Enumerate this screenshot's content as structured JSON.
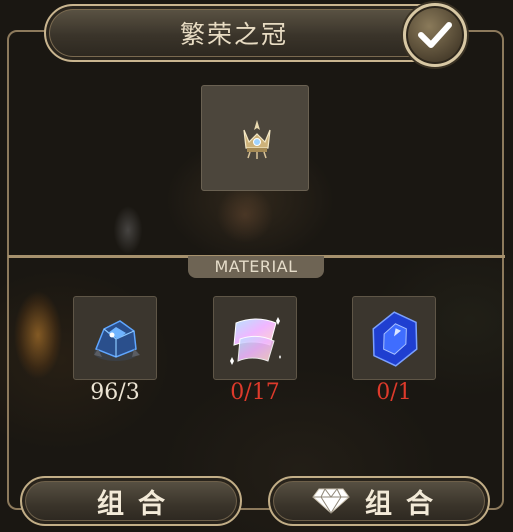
{
  "window": {
    "title": "繁荣之冠",
    "confirm_icon": "checkmark-icon"
  },
  "result": {
    "icon": "crown-icon",
    "slot_color": "#4c463c"
  },
  "materials_section": {
    "label": "MATERIAL",
    "items": [
      {
        "icon": "blue-crystal-ore-icon",
        "count": "96/3",
        "sufficient": true
      },
      {
        "icon": "rainbow-cloth-icon",
        "count": "0/17",
        "sufficient": false
      },
      {
        "icon": "sapphire-gem-icon",
        "count": "0/1",
        "sufficient": false
      }
    ]
  },
  "buttons": {
    "combine_label": "组合",
    "gem_combine_label": "组合",
    "gem_icon": "diamond-icon"
  },
  "colors": {
    "gold_frame": "#c9b58f",
    "count_ok": "#ece4d3",
    "count_short": "#dd3a2b",
    "title_text": "#e8dcc3"
  }
}
